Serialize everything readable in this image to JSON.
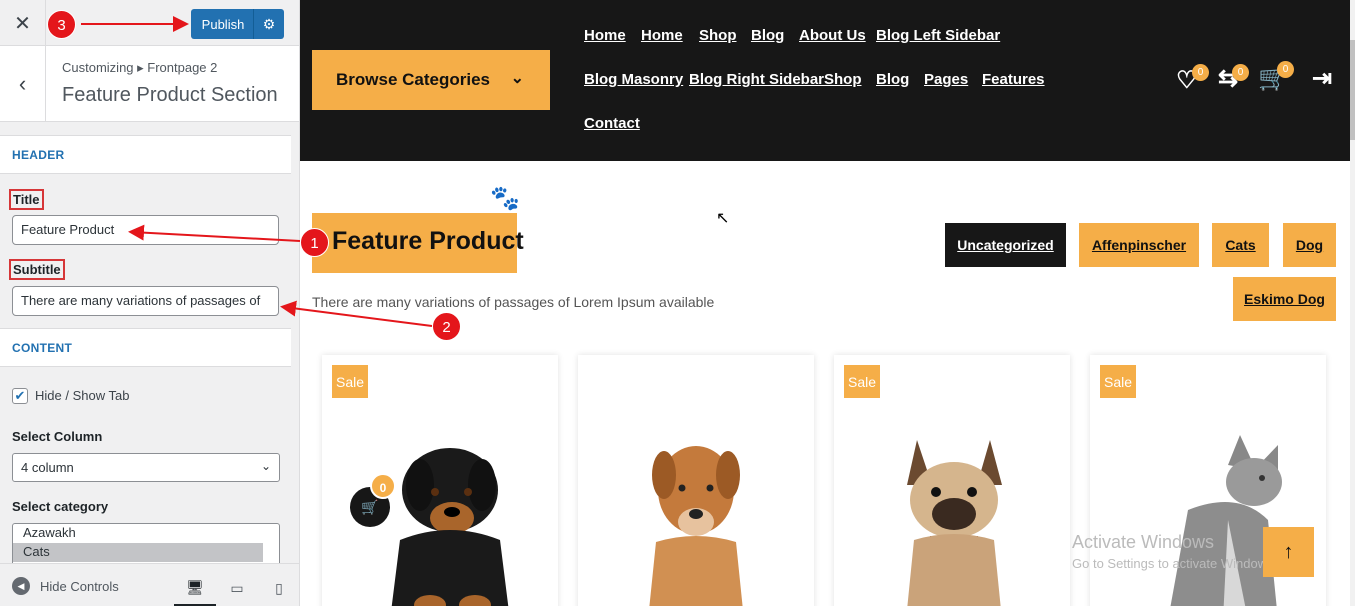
{
  "sidebar": {
    "close_icon": "close-icon",
    "publish_label": "Publish",
    "breadcrumb": "Customizing ▸ Frontpage 2",
    "section_title": "Feature Product Section",
    "header_heading": "HEADER",
    "title_label": "Title",
    "title_value": "Feature Product",
    "subtitle_label": "Subtitle",
    "subtitle_value": "There are many variations of passages of",
    "content_heading": "CONTENT",
    "hide_show_label": "Hide / Show Tab",
    "hide_show_checked": true,
    "select_column_label": "Select Column",
    "select_column_value": "4 column",
    "select_category_label": "Select category",
    "categories": [
      "Azawakh",
      "Cats"
    ],
    "hide_controls_label": "Hide Controls"
  },
  "preview": {
    "browse_label": "Browse Categories",
    "nav": [
      "Home",
      "Home",
      "Shop",
      "Blog",
      "About Us",
      "Blog Left Sidebar",
      "Blog Masonry",
      "Blog Right Sidebar",
      "Shop",
      "Blog",
      "Pages",
      "Features",
      "Contact"
    ],
    "wishlist_count": "0",
    "compare_count": "0",
    "cart_count": "0",
    "section_title": "Feature Product",
    "section_subtitle": "There are many variations of passages of Lorem Ipsum available",
    "category_tabs": [
      "Uncategorized",
      "Affenpinscher",
      "Cats",
      "Dog",
      "Eskimo Dog"
    ],
    "products": [
      {
        "badge": "Sale",
        "pet": "rottweiler puppy",
        "cart_count": "0"
      },
      {
        "badge": "",
        "pet": "brown dog"
      },
      {
        "badge": "Sale",
        "pet": "french bulldog"
      },
      {
        "badge": "Sale",
        "pet": "grey kitten"
      }
    ],
    "watermark_line1": "Activate Windows",
    "watermark_line2": "Go to Settings to activate Windows."
  },
  "annotations": [
    "1",
    "2",
    "3"
  ],
  "colors": {
    "accent": "#f5ae48",
    "header_bg": "#171717",
    "publish": "#2271b1",
    "annotation": "#e4161b"
  }
}
